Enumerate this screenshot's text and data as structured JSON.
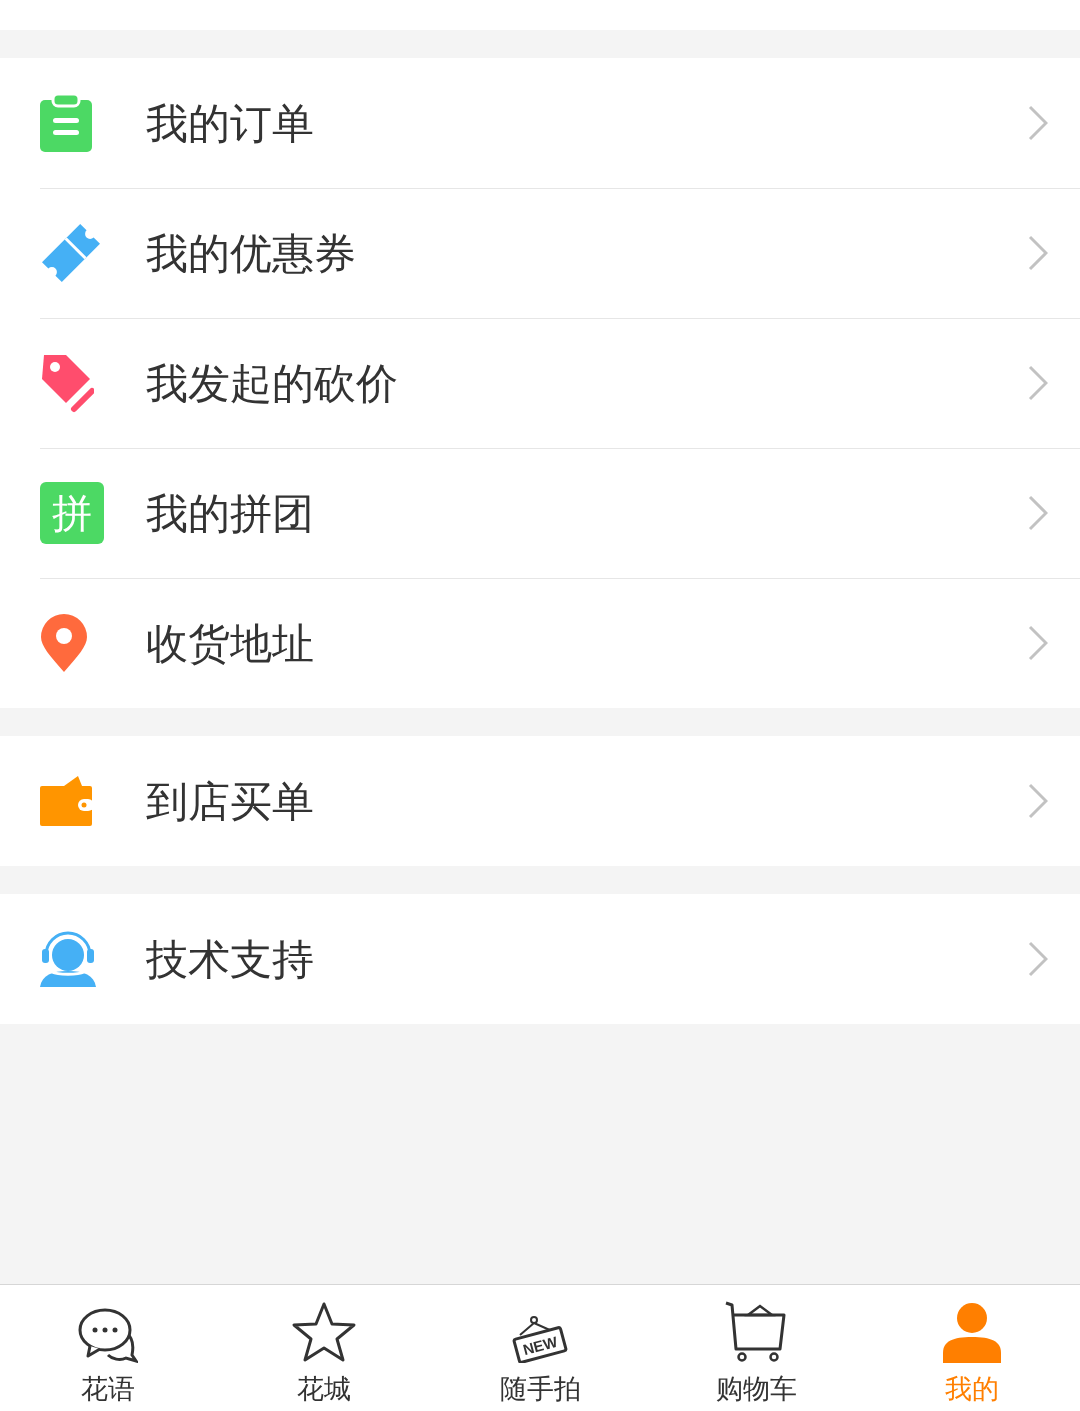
{
  "sections": [
    {
      "items": [
        {
          "label": "我的订单",
          "kind": "clipboard"
        },
        {
          "label": "我的优惠券",
          "kind": "ticket"
        },
        {
          "label": "我发起的砍价",
          "kind": "tag"
        },
        {
          "label": "我的拼团",
          "kind": "char",
          "icon_text": "拼"
        },
        {
          "label": "收货地址",
          "kind": "pin"
        }
      ]
    },
    {
      "items": [
        {
          "label": "到店买单",
          "kind": "wallet"
        }
      ]
    },
    {
      "items": [
        {
          "label": "技术支持",
          "kind": "support"
        }
      ]
    }
  ],
  "tabs": [
    {
      "label": "花语",
      "kind": "chat",
      "selected": false
    },
    {
      "label": "花城",
      "kind": "star",
      "selected": false
    },
    {
      "label": "随手拍",
      "kind": "sign",
      "icon_text": "NEW",
      "selected": false
    },
    {
      "label": "购物车",
      "kind": "cart",
      "selected": false
    },
    {
      "label": "我的",
      "kind": "person",
      "selected": true
    }
  ]
}
